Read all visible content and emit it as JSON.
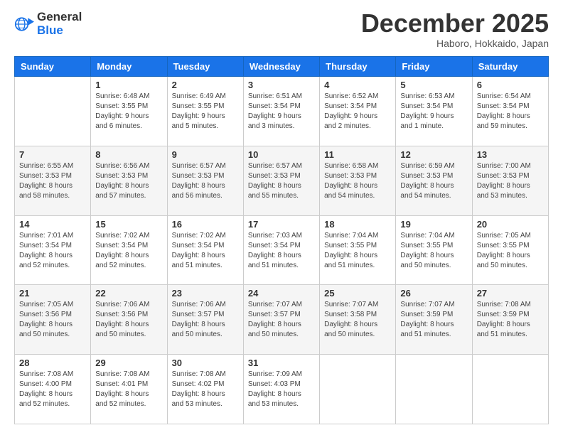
{
  "header": {
    "logo_line1": "General",
    "logo_line2": "Blue",
    "month": "December 2025",
    "location": "Haboro, Hokkaido, Japan"
  },
  "weekdays": [
    "Sunday",
    "Monday",
    "Tuesday",
    "Wednesday",
    "Thursday",
    "Friday",
    "Saturday"
  ],
  "weeks": [
    [
      {
        "day": "",
        "info": ""
      },
      {
        "day": "1",
        "info": "Sunrise: 6:48 AM\nSunset: 3:55 PM\nDaylight: 9 hours\nand 6 minutes."
      },
      {
        "day": "2",
        "info": "Sunrise: 6:49 AM\nSunset: 3:55 PM\nDaylight: 9 hours\nand 5 minutes."
      },
      {
        "day": "3",
        "info": "Sunrise: 6:51 AM\nSunset: 3:54 PM\nDaylight: 9 hours\nand 3 minutes."
      },
      {
        "day": "4",
        "info": "Sunrise: 6:52 AM\nSunset: 3:54 PM\nDaylight: 9 hours\nand 2 minutes."
      },
      {
        "day": "5",
        "info": "Sunrise: 6:53 AM\nSunset: 3:54 PM\nDaylight: 9 hours\nand 1 minute."
      },
      {
        "day": "6",
        "info": "Sunrise: 6:54 AM\nSunset: 3:54 PM\nDaylight: 8 hours\nand 59 minutes."
      }
    ],
    [
      {
        "day": "7",
        "info": "Sunrise: 6:55 AM\nSunset: 3:53 PM\nDaylight: 8 hours\nand 58 minutes."
      },
      {
        "day": "8",
        "info": "Sunrise: 6:56 AM\nSunset: 3:53 PM\nDaylight: 8 hours\nand 57 minutes."
      },
      {
        "day": "9",
        "info": "Sunrise: 6:57 AM\nSunset: 3:53 PM\nDaylight: 8 hours\nand 56 minutes."
      },
      {
        "day": "10",
        "info": "Sunrise: 6:57 AM\nSunset: 3:53 PM\nDaylight: 8 hours\nand 55 minutes."
      },
      {
        "day": "11",
        "info": "Sunrise: 6:58 AM\nSunset: 3:53 PM\nDaylight: 8 hours\nand 54 minutes."
      },
      {
        "day": "12",
        "info": "Sunrise: 6:59 AM\nSunset: 3:53 PM\nDaylight: 8 hours\nand 54 minutes."
      },
      {
        "day": "13",
        "info": "Sunrise: 7:00 AM\nSunset: 3:53 PM\nDaylight: 8 hours\nand 53 minutes."
      }
    ],
    [
      {
        "day": "14",
        "info": "Sunrise: 7:01 AM\nSunset: 3:54 PM\nDaylight: 8 hours\nand 52 minutes."
      },
      {
        "day": "15",
        "info": "Sunrise: 7:02 AM\nSunset: 3:54 PM\nDaylight: 8 hours\nand 52 minutes."
      },
      {
        "day": "16",
        "info": "Sunrise: 7:02 AM\nSunset: 3:54 PM\nDaylight: 8 hours\nand 51 minutes."
      },
      {
        "day": "17",
        "info": "Sunrise: 7:03 AM\nSunset: 3:54 PM\nDaylight: 8 hours\nand 51 minutes."
      },
      {
        "day": "18",
        "info": "Sunrise: 7:04 AM\nSunset: 3:55 PM\nDaylight: 8 hours\nand 51 minutes."
      },
      {
        "day": "19",
        "info": "Sunrise: 7:04 AM\nSunset: 3:55 PM\nDaylight: 8 hours\nand 50 minutes."
      },
      {
        "day": "20",
        "info": "Sunrise: 7:05 AM\nSunset: 3:55 PM\nDaylight: 8 hours\nand 50 minutes."
      }
    ],
    [
      {
        "day": "21",
        "info": "Sunrise: 7:05 AM\nSunset: 3:56 PM\nDaylight: 8 hours\nand 50 minutes."
      },
      {
        "day": "22",
        "info": "Sunrise: 7:06 AM\nSunset: 3:56 PM\nDaylight: 8 hours\nand 50 minutes."
      },
      {
        "day": "23",
        "info": "Sunrise: 7:06 AM\nSunset: 3:57 PM\nDaylight: 8 hours\nand 50 minutes."
      },
      {
        "day": "24",
        "info": "Sunrise: 7:07 AM\nSunset: 3:57 PM\nDaylight: 8 hours\nand 50 minutes."
      },
      {
        "day": "25",
        "info": "Sunrise: 7:07 AM\nSunset: 3:58 PM\nDaylight: 8 hours\nand 50 minutes."
      },
      {
        "day": "26",
        "info": "Sunrise: 7:07 AM\nSunset: 3:59 PM\nDaylight: 8 hours\nand 51 minutes."
      },
      {
        "day": "27",
        "info": "Sunrise: 7:08 AM\nSunset: 3:59 PM\nDaylight: 8 hours\nand 51 minutes."
      }
    ],
    [
      {
        "day": "28",
        "info": "Sunrise: 7:08 AM\nSunset: 4:00 PM\nDaylight: 8 hours\nand 52 minutes."
      },
      {
        "day": "29",
        "info": "Sunrise: 7:08 AM\nSunset: 4:01 PM\nDaylight: 8 hours\nand 52 minutes."
      },
      {
        "day": "30",
        "info": "Sunrise: 7:08 AM\nSunset: 4:02 PM\nDaylight: 8 hours\nand 53 minutes."
      },
      {
        "day": "31",
        "info": "Sunrise: 7:09 AM\nSunset: 4:03 PM\nDaylight: 8 hours\nand 53 minutes."
      },
      {
        "day": "",
        "info": ""
      },
      {
        "day": "",
        "info": ""
      },
      {
        "day": "",
        "info": ""
      }
    ]
  ]
}
